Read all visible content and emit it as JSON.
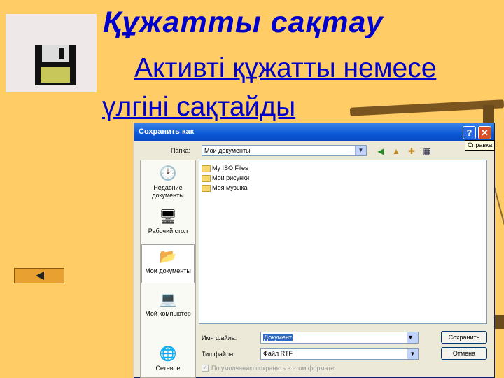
{
  "slide": {
    "title": "Құжатты  сақтау",
    "subtitle": "Активті құжатты немесе үлгіні сақтайды",
    "floppy_icon": "floppy-disk-icon",
    "back_icon": "left-arrow-icon"
  },
  "dialog": {
    "title": "Сохранить как",
    "help_label": "?",
    "close_label": "✕",
    "tooltip": "Справка",
    "folder_label": "Папка:",
    "folder_value": "Мои документы",
    "places": [
      {
        "label": "Недавние документы",
        "icon": "recent-documents-icon"
      },
      {
        "label": "Рабочий стол",
        "icon": "desktop-icon"
      },
      {
        "label": "Мои документы",
        "icon": "my-documents-icon"
      },
      {
        "label": "Мой компьютер",
        "icon": "my-computer-icon"
      },
      {
        "label": "Сетевое",
        "icon": "network-icon"
      }
    ],
    "files": [
      {
        "name": "My ISO Files",
        "icon": "folder-icon"
      },
      {
        "name": "Мои рисунки",
        "icon": "folder-icon"
      },
      {
        "name": "Моя музыка",
        "icon": "folder-icon"
      }
    ],
    "filename_label": "Имя файла:",
    "filename_value": "Документ",
    "filetype_label": "Тип файла:",
    "filetype_value": "Файл RTF",
    "save_button": "Сохранить",
    "cancel_button": "Отмена",
    "checkbox_label": "По умолчанию сохранять в этом формате"
  },
  "colors": {
    "background": "#FFCC66",
    "title_text": "#0000CC",
    "titlebar": "#0A57D6"
  }
}
